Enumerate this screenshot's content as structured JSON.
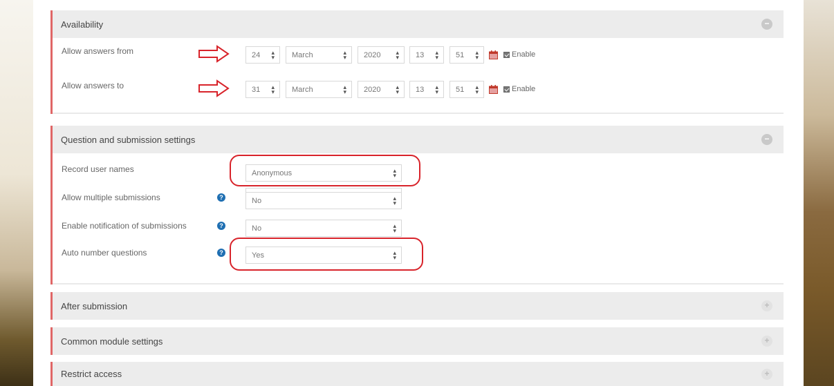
{
  "availability": {
    "title": "Availability",
    "rows": [
      {
        "label": "Allow answers from",
        "day": "24",
        "month": "March",
        "year": "2020",
        "hour": "13",
        "minute": "51",
        "enable": "Enable"
      },
      {
        "label": "Allow answers to",
        "day": "31",
        "month": "March",
        "year": "2020",
        "hour": "13",
        "minute": "51",
        "enable": "Enable"
      }
    ]
  },
  "questions": {
    "title": "Question and submission settings",
    "record_label": "Record user names",
    "record_value": "Anonymous",
    "multiple_label": "Allow multiple submissions",
    "multiple_value": "No",
    "notify_label": "Enable notification of submissions",
    "notify_value": "No",
    "autonumber_label": "Auto number questions",
    "autonumber_value": "Yes"
  },
  "collapsed": {
    "after": "After submission",
    "common": "Common module settings",
    "restrict": "Restrict access"
  },
  "icons": {
    "collapse": "minus-circle-icon",
    "expand": "plus-circle-icon",
    "help": "question-circle-icon",
    "calendar": "calendar-icon",
    "select_arrow": "sort-arrows-icon"
  },
  "colors": {
    "accent": "#e06666",
    "annotation": "#d8232a",
    "help": "#1f6fb2"
  }
}
